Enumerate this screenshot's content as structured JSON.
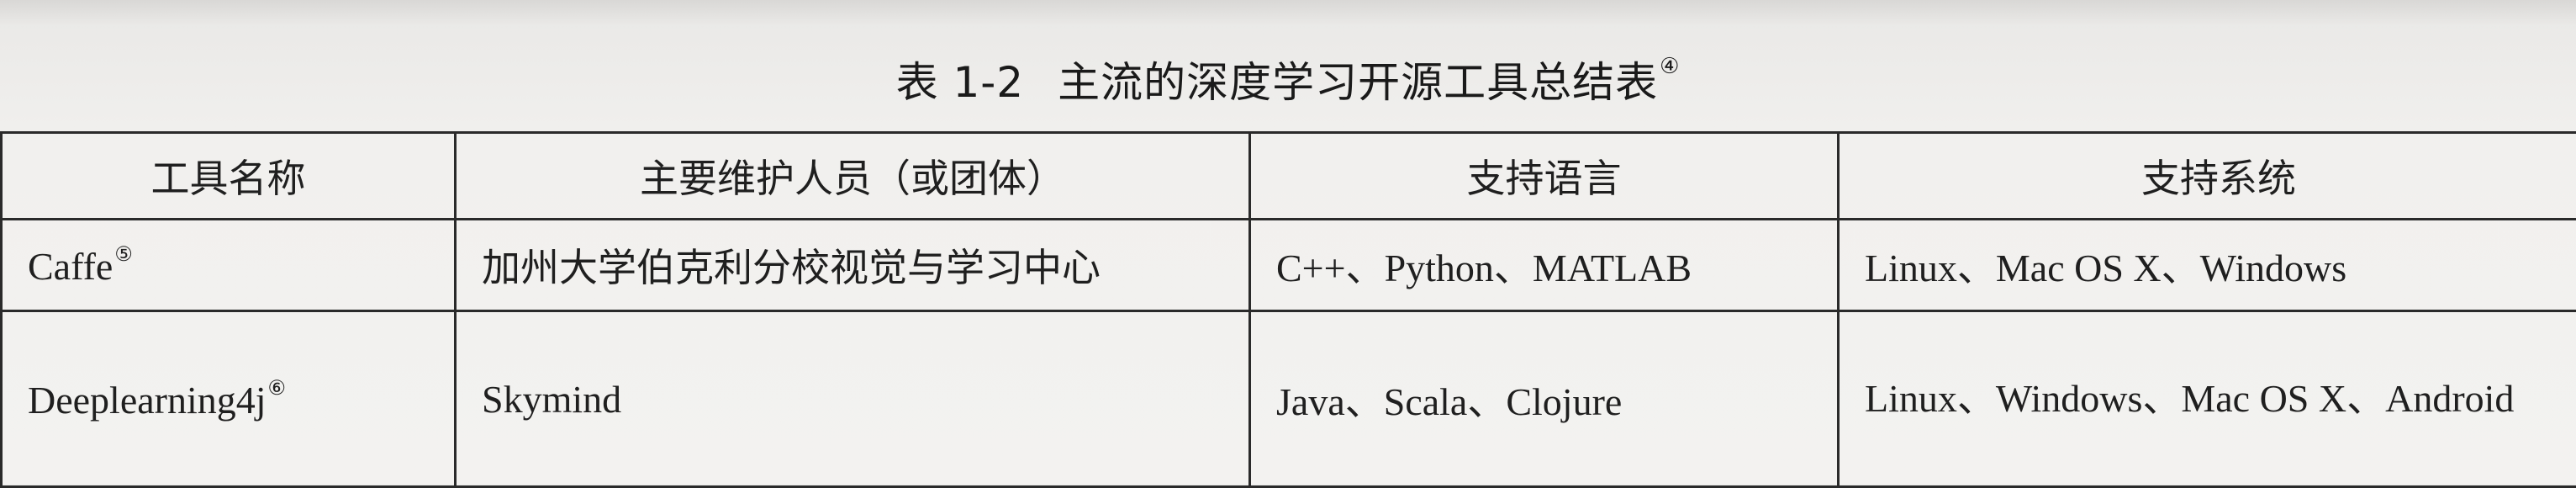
{
  "caption": {
    "number": "表 1-2",
    "title": "主流的深度学习开源工具总结表",
    "note_mark": "④"
  },
  "table": {
    "headers": [
      "工具名称",
      "主要维护人员（或团体）",
      "支持语言",
      "支持系统"
    ],
    "rows": [
      {
        "tool": "Caffe",
        "tool_mark": "⑤",
        "maintainer": "加州大学伯克利分校视觉与学习中心",
        "languages": "C++、Python、MATLAB",
        "systems": "Linux、Mac OS X、Windows"
      },
      {
        "tool": "Deeplearning4j",
        "tool_mark": "⑥",
        "maintainer": "Skymind",
        "languages": "Java、Scala、Clojure",
        "systems": "Linux、Windows、Mac OS X、Android"
      }
    ]
  }
}
